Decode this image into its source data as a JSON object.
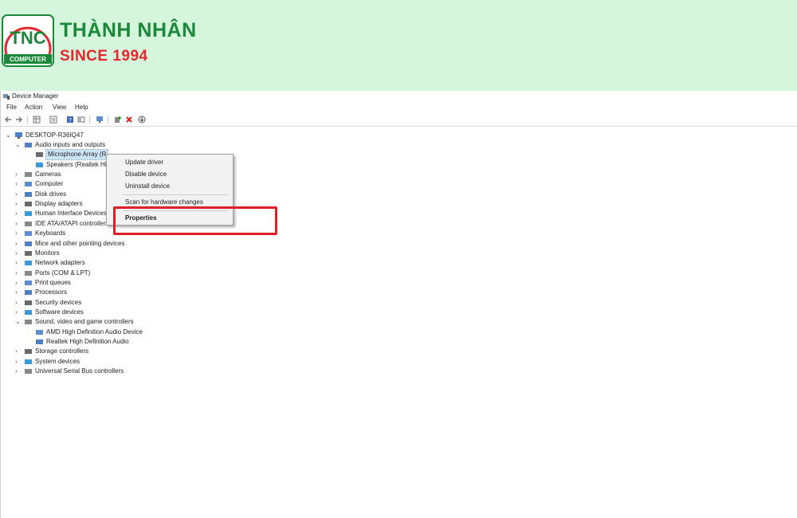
{
  "banner": {
    "logo_letters": "TNC",
    "logo_sub": "COMPUTER",
    "brand_name": "THÀNH NHÂN",
    "tagline": "SINCE 1994",
    "colors": {
      "green": "#1a8a3a",
      "red": "#e4272d",
      "background": "#d5f6dc"
    }
  },
  "window": {
    "title": "Device Manager"
  },
  "menu": [
    "File",
    "Action",
    "View",
    "Help"
  ],
  "toolbar": {
    "buttons": [
      "back-icon",
      "forward-icon",
      "properties-grid-icon",
      "update-list-icon",
      "help-icon",
      "show-panel-icon",
      "monitor-icon",
      "add-driver-icon",
      "uninstall-icon",
      "download-icon"
    ],
    "accent_red": "#d62020"
  },
  "tree": {
    "root": "DESKTOP-R36IQ47",
    "nodes": [
      {
        "label": "Audio inputs and outputs",
        "expanded": true,
        "icon": "speaker-icon"
      },
      {
        "label": "Microphone Array (R",
        "child": true,
        "selected": true,
        "icon": "microphone-icon"
      },
      {
        "label": "Speakers (Realtek Hig",
        "child": true,
        "icon": "speaker-icon"
      },
      {
        "label": "Cameras",
        "icon": "camera-icon"
      },
      {
        "label": "Computer",
        "icon": "computer-icon"
      },
      {
        "label": "Disk drives",
        "icon": "disk-icon"
      },
      {
        "label": "Display adapters",
        "icon": "display-icon"
      },
      {
        "label": "Human Interface Devices",
        "icon": "hid-icon"
      },
      {
        "label": "IDE ATA/ATAPI controllers",
        "icon": "ide-icon"
      },
      {
        "label": "Keyboards",
        "icon": "keyboard-icon"
      },
      {
        "label": "Mice and other pointing devices",
        "icon": "mouse-icon"
      },
      {
        "label": "Monitors",
        "icon": "monitor-icon"
      },
      {
        "label": "Network adapters",
        "icon": "network-icon"
      },
      {
        "label": "Ports (COM & LPT)",
        "icon": "port-icon"
      },
      {
        "label": "Print queues",
        "icon": "printer-icon"
      },
      {
        "label": "Processors",
        "icon": "processor-icon"
      },
      {
        "label": "Security devices",
        "icon": "security-icon"
      },
      {
        "label": "Software devices",
        "icon": "software-icon"
      },
      {
        "label": "Sound, video and game controllers",
        "expanded": true,
        "icon": "speaker-icon"
      },
      {
        "label": "AMD High Definition Audio Device",
        "child": true,
        "icon": "speaker-icon"
      },
      {
        "label": "Realtek High Definition Audio",
        "child": true,
        "icon": "speaker-icon"
      },
      {
        "label": "Storage controllers",
        "icon": "storage-icon"
      },
      {
        "label": "System devices",
        "icon": "system-icon"
      },
      {
        "label": "Universal Serial Bus controllers",
        "icon": "usb-icon"
      }
    ]
  },
  "context_menu": {
    "items": [
      "Update driver",
      "Disable device",
      "Uninstall device",
      "Scan for hardware changes",
      "Properties"
    ],
    "highlight_color": "#e01e26"
  }
}
